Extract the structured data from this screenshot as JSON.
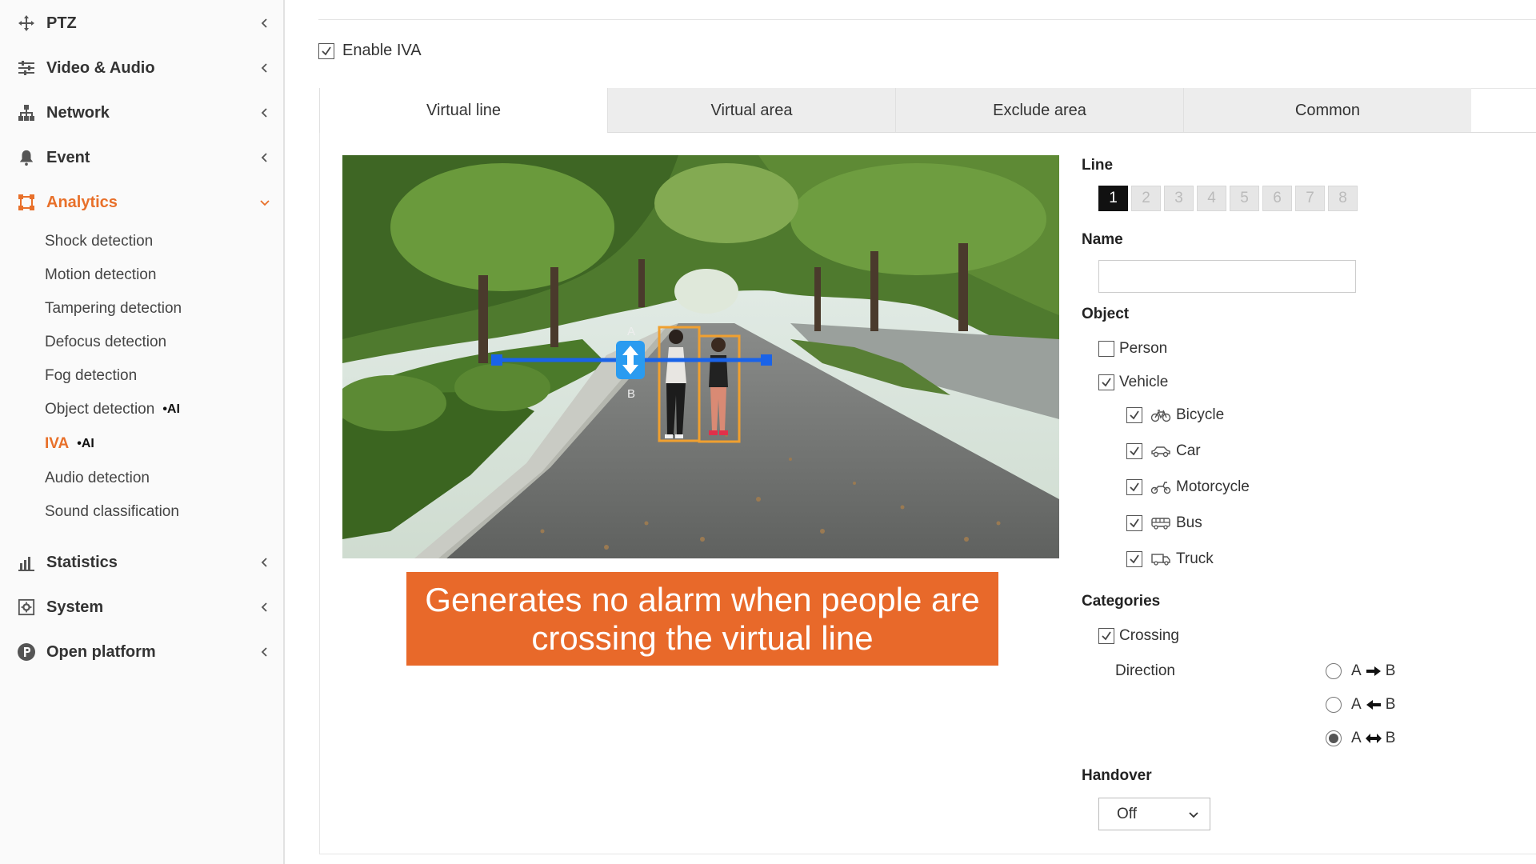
{
  "sidebar": {
    "items": [
      {
        "label": "PTZ",
        "icon": "move-arrows-icon"
      },
      {
        "label": "Video & Audio",
        "icon": "sliders-icon"
      },
      {
        "label": "Network",
        "icon": "network-tree-icon"
      },
      {
        "label": "Event",
        "icon": "bell-icon"
      },
      {
        "label": "Analytics",
        "icon": "analytics-frame-icon"
      },
      {
        "label": "Statistics",
        "icon": "bar-chart-icon"
      },
      {
        "label": "System",
        "icon": "gear-box-icon"
      },
      {
        "label": "Open platform",
        "icon": "p-circle-icon"
      }
    ],
    "analytics_sub": [
      {
        "label": "Shock detection",
        "ai": ""
      },
      {
        "label": "Motion detection",
        "ai": ""
      },
      {
        "label": "Tampering detection",
        "ai": ""
      },
      {
        "label": "Defocus detection",
        "ai": ""
      },
      {
        "label": "Fog detection",
        "ai": ""
      },
      {
        "label": "Object detection",
        "ai": "•AI"
      },
      {
        "label": "IVA",
        "ai": "•AI"
      },
      {
        "label": "Audio detection",
        "ai": ""
      },
      {
        "label": "Sound classification",
        "ai": ""
      }
    ],
    "active_color": "#e8702a"
  },
  "main": {
    "enable_label": "Enable IVA",
    "enable_checked": true,
    "tabs": [
      {
        "label": "Virtual line"
      },
      {
        "label": "Virtual area"
      },
      {
        "label": "Exclude area"
      },
      {
        "label": "Common"
      }
    ],
    "video": {
      "label_a": "A",
      "label_b": "B"
    },
    "caption": "Generates no alarm when people are crossing the virtual line",
    "caption_color": "#e8692a"
  },
  "settings": {
    "line_title": "Line",
    "lines": [
      "1",
      "2",
      "3",
      "4",
      "5",
      "6",
      "7",
      "8"
    ],
    "name_title": "Name",
    "name_value": "",
    "object_title": "Object",
    "person": {
      "label": "Person",
      "checked": false
    },
    "vehicle": {
      "label": "Vehicle",
      "checked": true
    },
    "vehicles": [
      {
        "label": "Bicycle",
        "icon": "bicycle-icon",
        "checked": true
      },
      {
        "label": "Car",
        "icon": "car-icon",
        "checked": true
      },
      {
        "label": "Motorcycle",
        "icon": "motorcycle-icon",
        "checked": true
      },
      {
        "label": "Bus",
        "icon": "bus-icon",
        "checked": true
      },
      {
        "label": "Truck",
        "icon": "truck-icon",
        "checked": true
      }
    ],
    "categories_title": "Categories",
    "crossing": {
      "label": "Crossing",
      "checked": true
    },
    "direction_label": "Direction",
    "directions": [
      {
        "from": "A",
        "to": "B",
        "arrow": "right-arrow-icon",
        "selected": false
      },
      {
        "from": "A",
        "to": "B",
        "arrow": "left-arrow-icon",
        "selected": false
      },
      {
        "from": "A",
        "to": "B",
        "arrow": "both-arrow-icon",
        "selected": true
      }
    ],
    "handover_title": "Handover",
    "handover_value": "Off"
  }
}
